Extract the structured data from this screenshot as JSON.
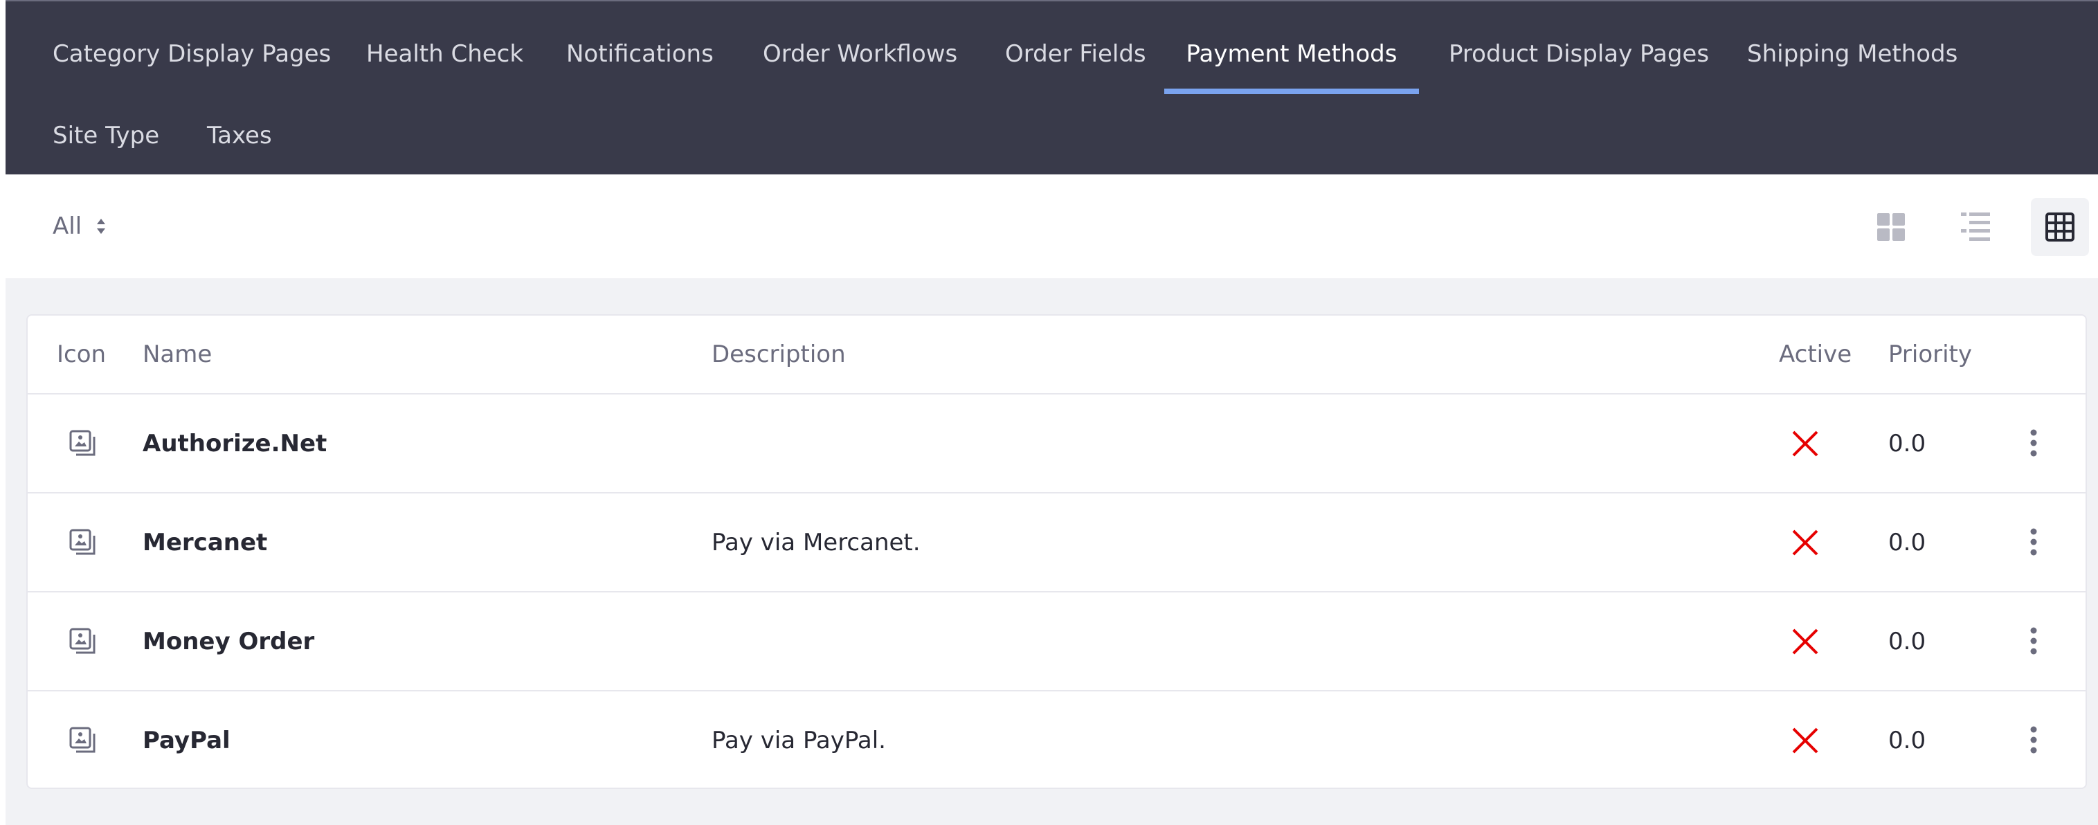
{
  "nav": {
    "tabs": [
      {
        "label": "Category Display Pages",
        "active": false
      },
      {
        "label": "Health Check",
        "active": false
      },
      {
        "label": "Notifications",
        "active": false
      },
      {
        "label": "Order Workflows",
        "active": false
      },
      {
        "label": "Order Fields",
        "active": false
      },
      {
        "label": "Payment Methods",
        "active": true
      },
      {
        "label": "Product Display Pages",
        "active": false
      },
      {
        "label": "Shipping Methods",
        "active": false
      },
      {
        "label": "Site Type",
        "active": false
      },
      {
        "label": "Taxes",
        "active": false
      }
    ]
  },
  "toolbar": {
    "filter_label": "All",
    "views": [
      {
        "icon": "cards-view-icon",
        "active": false
      },
      {
        "icon": "list-view-icon",
        "active": false
      },
      {
        "icon": "table-view-icon",
        "active": true
      }
    ]
  },
  "table": {
    "headers": {
      "icon": "Icon",
      "name": "Name",
      "description": "Description",
      "active": "Active",
      "priority": "Priority"
    },
    "rows": [
      {
        "name": "Authorize.Net",
        "description": "",
        "active": false,
        "priority": "0.0"
      },
      {
        "name": "Mercanet",
        "description": "Pay via Mercanet.",
        "active": false,
        "priority": "0.0"
      },
      {
        "name": "Money Order",
        "description": "",
        "active": false,
        "priority": "0.0"
      },
      {
        "name": "PayPal",
        "description": "Pay via PayPal.",
        "active": false,
        "priority": "0.0"
      }
    ]
  },
  "colors": {
    "nav_background": "#393a4a",
    "active_tab_underline": "#7aa3ef",
    "inactive_status": "#e60000",
    "text_primary": "#272833",
    "text_secondary": "#6b6c7e"
  }
}
